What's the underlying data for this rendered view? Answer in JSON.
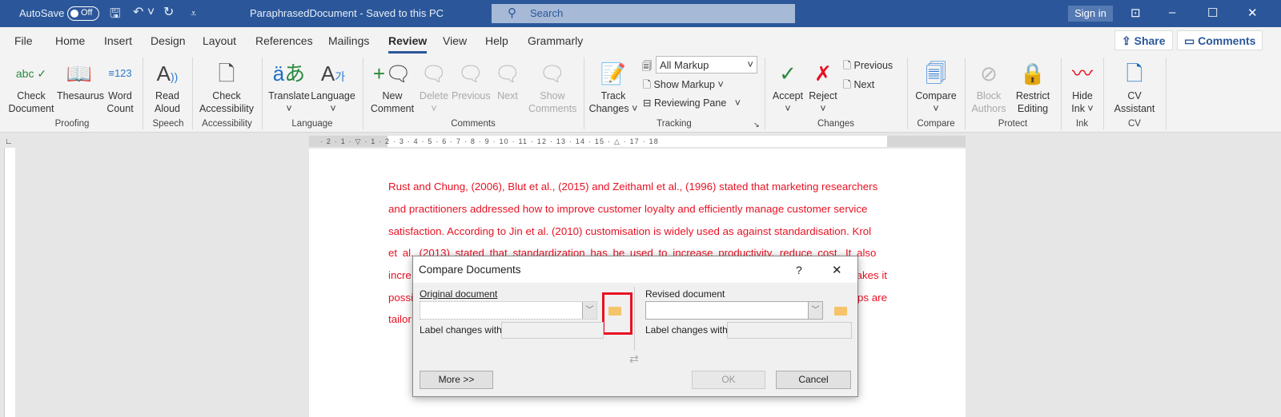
{
  "titlebar": {
    "autosave": "AutoSave",
    "toggle": "Off",
    "doc_title": "ParaphrasedDocument  -  Saved to this PC",
    "search_placeholder": "Search",
    "sign_in": "Sign in"
  },
  "menu_tabs": [
    "File",
    "Home",
    "Insert",
    "Design",
    "Layout",
    "References",
    "Mailings",
    "Review",
    "View",
    "Help",
    "Grammarly"
  ],
  "active_tab": "Review",
  "share": "Share",
  "comments": "Comments",
  "ribbon": {
    "buttons": {
      "check_document": "Check Document",
      "thesaurus": "Thesaurus",
      "word_count": "Word Count",
      "read_aloud": "Read Aloud",
      "check_accessibility": "Check Accessibility",
      "translate": "Translate",
      "language": "Language",
      "new_comment": "New Comment",
      "delete": "Delete",
      "previous": "Previous",
      "next": "Next",
      "show_comments": "Show Comments",
      "track_changes": "Track Changes",
      "all_markup": "All Markup",
      "show_markup": "Show Markup",
      "reviewing_pane": "Reviewing Pane",
      "accept": "Accept",
      "reject": "Reject",
      "prev_change": "Previous",
      "next_change": "Next",
      "compare": "Compare",
      "block_authors": "Block Authors",
      "restrict_editing": "Restrict Editing",
      "hide_ink": "Hide Ink",
      "cv_assistant": "CV Assistant"
    },
    "groups": [
      "Proofing",
      "Speech",
      "Accessibility",
      "Language",
      "Comments",
      "Tracking",
      "Changes",
      "Compare",
      "Protect",
      "Ink",
      "CV"
    ]
  },
  "ruler": "· 2 · 1 · ▽ · 1 · 2 · 3 · 4 · 5 · 6 · 7 · 8 · 9 · 10 · 11 · 12 · 13 · 14 · 15 · △ · 17 · 18",
  "document": {
    "lines": [
      "Rust and Chung, (2006), Blut et al., (2015) and Zeithaml et al., (1996) stated that marketing researchers",
      "and practitioners addressed how to improve customer loyalty and efficiently manage customer service",
      "satisfaction. According to Jin et al. (2010) customisation is widely used as against standardisation. Krol",
      "et al. (2013) stated that standardization has be used to increase productivity, reduce cost. It also",
      "incre",
      "possi",
      "tailor"
    ],
    "line5_end": "akes it",
    "line6_end": "ps are"
  },
  "dialog": {
    "title": "Compare Documents",
    "help": "?",
    "close": "✕",
    "original_label": "Original document",
    "revised_label": "Revised document",
    "label_changes": "Label changes with",
    "original_value": "",
    "revised_value": "",
    "more": "More >>",
    "ok": "OK",
    "cancel": "Cancel"
  },
  "highlight_color": "#e81123"
}
